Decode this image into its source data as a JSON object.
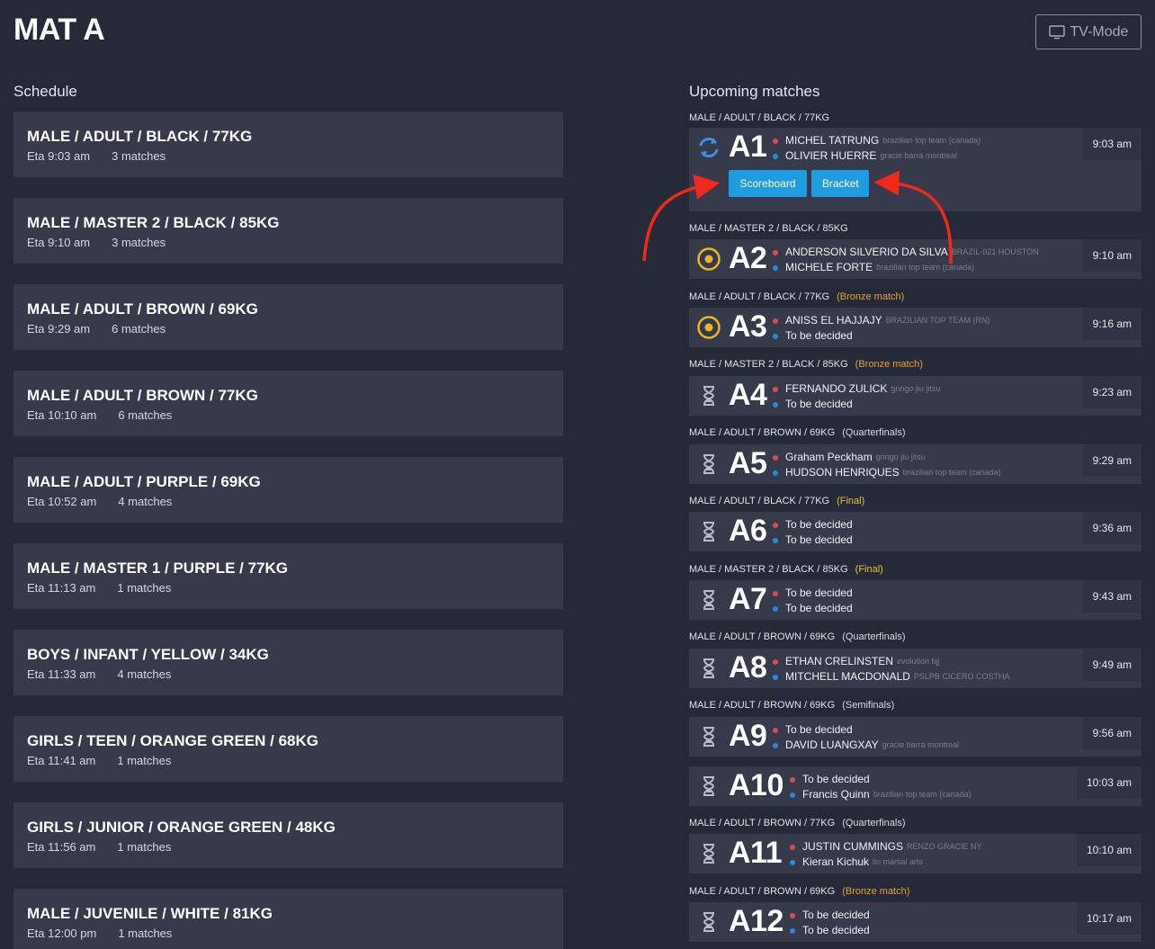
{
  "page": {
    "title": "MAT A",
    "tv_mode_label": "TV-Mode"
  },
  "schedule": {
    "heading": "Schedule",
    "items": [
      {
        "title": "MALE / ADULT / BLACK / 77KG",
        "eta": "Eta 9:03 am",
        "matches": "3 matches"
      },
      {
        "title": "MALE / MASTER 2 / BLACK / 85KG",
        "eta": "Eta 9:10 am",
        "matches": "3 matches"
      },
      {
        "title": "MALE / ADULT / BROWN / 69KG",
        "eta": "Eta 9:29 am",
        "matches": "6 matches"
      },
      {
        "title": "MALE / ADULT / BROWN / 77KG",
        "eta": "Eta 10:10 am",
        "matches": "6 matches"
      },
      {
        "title": "MALE / ADULT / PURPLE / 69KG",
        "eta": "Eta 10:52 am",
        "matches": "4 matches"
      },
      {
        "title": "MALE / MASTER 1 / PURPLE / 77KG",
        "eta": "Eta 11:13 am",
        "matches": "1 matches"
      },
      {
        "title": "BOYS / INFANT / YELLOW / 34KG",
        "eta": "Eta 11:33 am",
        "matches": "4 matches"
      },
      {
        "title": "GIRLS / TEEN / ORANGE GREEN / 68KG",
        "eta": "Eta 11:41 am",
        "matches": "1 matches"
      },
      {
        "title": "GIRLS / JUNIOR / ORANGE GREEN / 48KG",
        "eta": "Eta 11:56 am",
        "matches": "1 matches"
      },
      {
        "title": "MALE / JUVENILE / WHITE / 81KG",
        "eta": "Eta 12:00 pm",
        "matches": "1 matches"
      }
    ]
  },
  "upcoming": {
    "heading": "Upcoming matches",
    "actions": {
      "scoreboard": "Scoreboard",
      "bracket": "Bracket"
    },
    "matches": [
      {
        "label": "MALE / ADULT / BLACK / 77KG",
        "round": "",
        "round_color": "",
        "number": "A1",
        "status": "sync-icon",
        "red": {
          "name": "MICHEL TATRUNG",
          "team": "brazilian top team (canada)"
        },
        "blue": {
          "name": "OLIVIER HUERRE",
          "team": "gracie barra montreal"
        },
        "time": "9:03 am"
      },
      {
        "label": "MALE / MASTER 2 / BLACK / 85KG",
        "round": "",
        "round_color": "",
        "number": "A2",
        "status": "in-progress-icon",
        "red": {
          "name": "ANDERSON SILVERIO DA SILVA",
          "team": "BRAZIL-021 HOUSTON"
        },
        "blue": {
          "name": "MICHELE FORTE",
          "team": "brazilian top team (canada)"
        },
        "time": "9:10 am"
      },
      {
        "label": "MALE / ADULT / BLACK / 77KG",
        "round": "(Bronze match)",
        "round_color": "orange",
        "number": "A3",
        "status": "in-progress-icon",
        "red": {
          "name": "ANISS EL HAJJAJY",
          "team": "BRAZILIAN TOP TEAM (RN)"
        },
        "blue": {
          "name": "To be decided",
          "team": ""
        },
        "time": "9:16 am"
      },
      {
        "label": "MALE / MASTER 2 / BLACK / 85KG",
        "round": "(Bronze match)",
        "round_color": "orange",
        "number": "A4",
        "status": "hourglass-icon",
        "red": {
          "name": "FERNANDO ZULICK",
          "team": "gringo jiu jitsu"
        },
        "blue": {
          "name": "To be decided",
          "team": ""
        },
        "time": "9:23 am"
      },
      {
        "label": "MALE / ADULT / BROWN / 69KG",
        "round": "(Quarterfinals)",
        "round_color": "",
        "number": "A5",
        "status": "hourglass-icon",
        "red": {
          "name": "Graham Peckham",
          "team": "gringo jiu jitsu"
        },
        "blue": {
          "name": "HUDSON HENRIQUES",
          "team": "brazilian top team (canada)"
        },
        "time": "9:29 am"
      },
      {
        "label": "MALE / ADULT / BLACK / 77KG",
        "round": "(Final)",
        "round_color": "yellow",
        "number": "A6",
        "status": "hourglass-icon",
        "red": {
          "name": "To be decided",
          "team": ""
        },
        "blue": {
          "name": "To be decided",
          "team": ""
        },
        "time": "9:36 am"
      },
      {
        "label": "MALE / MASTER 2 / BLACK / 85KG",
        "round": "(Final)",
        "round_color": "yellow",
        "number": "A7",
        "status": "hourglass-icon",
        "red": {
          "name": "To be decided",
          "team": ""
        },
        "blue": {
          "name": "To be decided",
          "team": ""
        },
        "time": "9:43 am"
      },
      {
        "label": "MALE / ADULT / BROWN / 69KG",
        "round": "(Quarterfinals)",
        "round_color": "",
        "number": "A8",
        "status": "hourglass-icon",
        "red": {
          "name": "ETHAN CRELINSTEN",
          "team": "evolution bjj"
        },
        "blue": {
          "name": "MITCHELL MACDONALD",
          "team": "PSLPB CICERO COSTHA"
        },
        "time": "9:49 am"
      },
      {
        "label": "MALE / ADULT / BROWN / 69KG",
        "round": "(Semifinals)",
        "round_color": "",
        "number": "A9",
        "status": "hourglass-icon",
        "red": {
          "name": "To be decided",
          "team": ""
        },
        "blue": {
          "name": "DAVID LUANGXAY",
          "team": "gracie barra montreal"
        },
        "time": "9:56 am"
      },
      {
        "label": "",
        "round": "",
        "round_color": "",
        "number": "A10",
        "status": "hourglass-icon",
        "red": {
          "name": "To be decided",
          "team": ""
        },
        "blue": {
          "name": "Francis Quinn",
          "team": "brazilian top team (canada)"
        },
        "time": "10:03 am"
      },
      {
        "label": "MALE / ADULT / BROWN / 77KG",
        "round": "(Quarterfinals)",
        "round_color": "",
        "number": "A11",
        "status": "hourglass-icon",
        "red": {
          "name": "JUSTIN CUMMINGS",
          "team": "RENZO GRACIE NY"
        },
        "blue": {
          "name": "Kieran Kichuk",
          "team": "lin martial arts"
        },
        "time": "10:10 am"
      },
      {
        "label": "MALE / ADULT / BROWN / 69KG",
        "round": "(Bronze match)",
        "round_color": "orange",
        "number": "A12",
        "status": "hourglass-icon",
        "red": {
          "name": "To be decided",
          "team": ""
        },
        "blue": {
          "name": "To be decided",
          "team": ""
        },
        "time": "10:17 am"
      }
    ]
  },
  "colors": {
    "background": "#262a38",
    "card": "#363a4b",
    "accent_button": "#1f9be0",
    "red_corner": "#d94b5b",
    "blue_corner": "#2d86e0",
    "bronze_round": "#e3a13a",
    "final_round": "#e8c03a",
    "annotation_arrow": "#f0291c"
  }
}
